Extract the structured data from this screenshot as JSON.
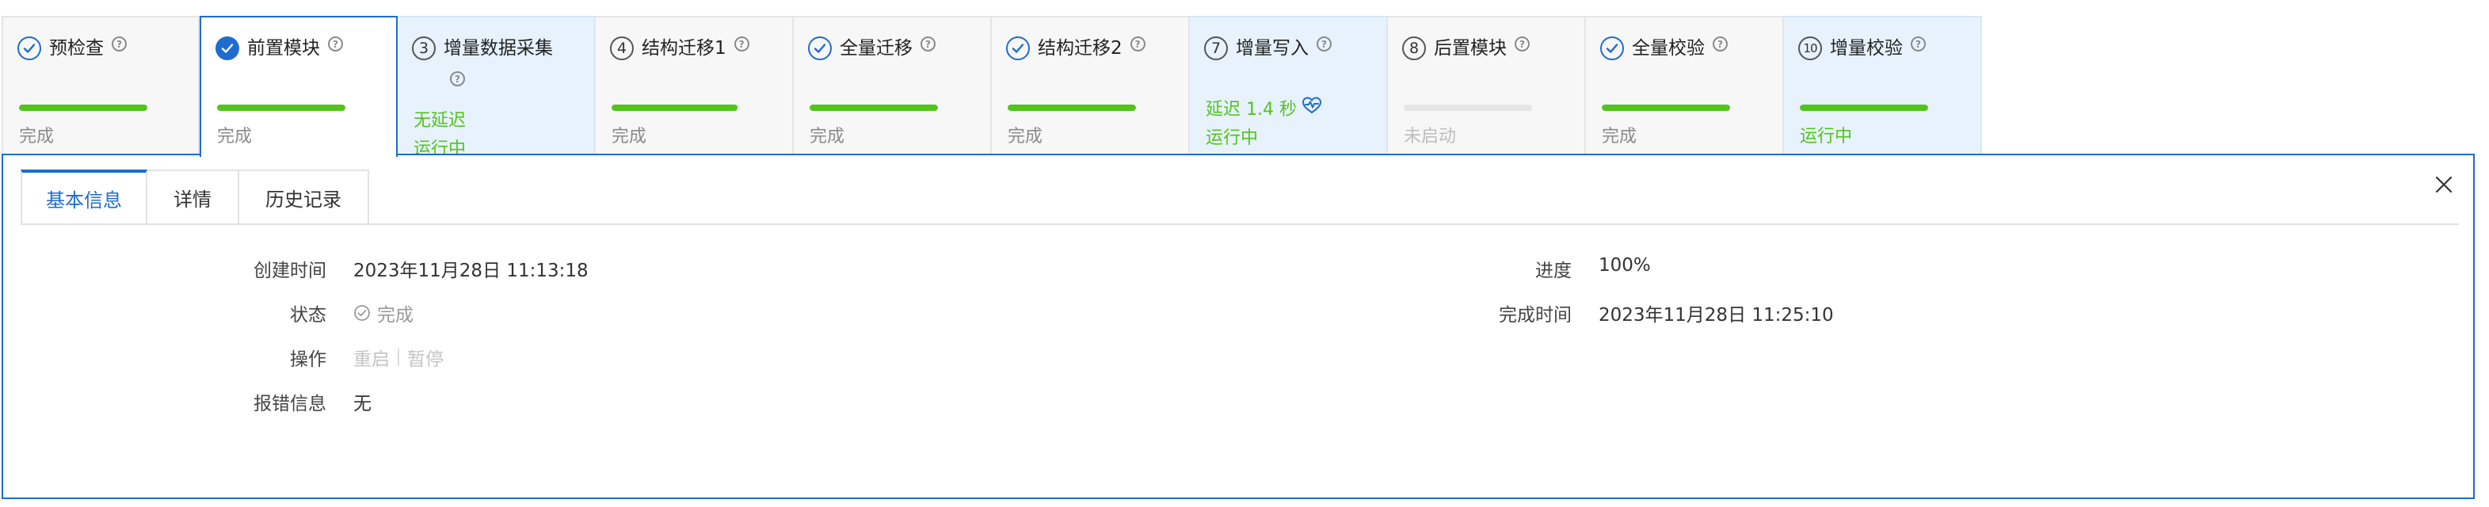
{
  "steps": [
    {
      "label": "预检查",
      "state": "done",
      "status": "完成",
      "progress": 1.0
    },
    {
      "label": "前置模块",
      "state": "done",
      "status": "完成",
      "progress": 1.0,
      "selected": true
    },
    {
      "label": "增量数据采集",
      "number": "3",
      "state": "running",
      "status": "无延迟",
      "sub_status": "运行中"
    },
    {
      "label": "结构迁移1",
      "number": "4",
      "state": "done",
      "status": "完成",
      "progress": 1.0
    },
    {
      "label": "全量迁移",
      "state": "done",
      "status": "完成",
      "progress": 1.0
    },
    {
      "label": "结构迁移2",
      "state": "done",
      "status": "完成",
      "progress": 1.0
    },
    {
      "label": "增量写入",
      "number": "7",
      "state": "running",
      "latency": "延迟 1.4 秒",
      "sub_status": "运行中"
    },
    {
      "label": "后置模块",
      "number": "8",
      "state": "not_started",
      "status": "未启动",
      "progress": 0.0
    },
    {
      "label": "全量校验",
      "state": "done",
      "status": "完成",
      "progress": 1.0
    },
    {
      "label": "增量校验",
      "number": "10",
      "state": "running",
      "status": "运行中",
      "progress": 1.0
    }
  ],
  "panel": {
    "tabs": [
      "基本信息",
      "详情",
      "历史记录"
    ],
    "active_tab": 0,
    "left": {
      "created_label": "创建时间",
      "created_value": "2023年11月28日 11:13:18",
      "status_label": "状态",
      "status_value": "完成",
      "ops_label": "操作",
      "restart": "重启",
      "pause": "暂停",
      "error_label": "报错信息",
      "error_value": "无"
    },
    "right": {
      "progress_label": "进度",
      "progress_value": "100%",
      "finished_label": "完成时间",
      "finished_value": "2023年11月28日 11:25:10"
    }
  },
  "colors": {
    "primary": "#1e6ccf",
    "success": "#52c41a",
    "running_bg": "#e7f2fd",
    "done_bg": "#f7f7f7",
    "muted_text": "#8a8a8a"
  },
  "icons": {
    "done": "check-circle-icon",
    "help": "question-circle-icon",
    "heartbeat": "heartbeat-icon",
    "close": "close-icon",
    "status_done": "check-circle-small-icon"
  }
}
